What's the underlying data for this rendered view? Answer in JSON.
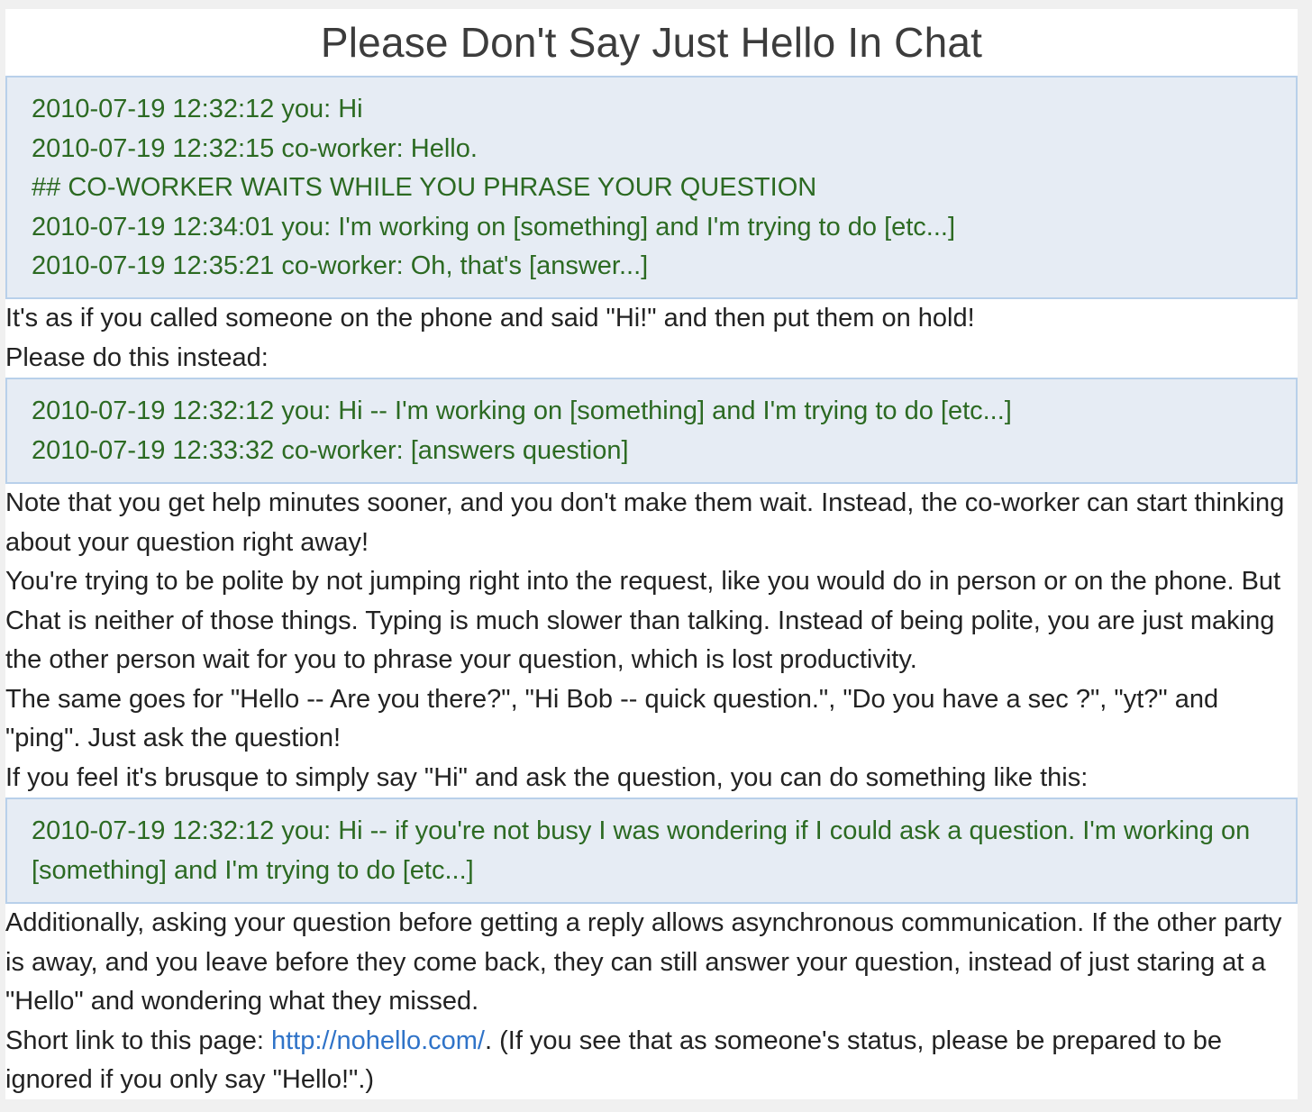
{
  "title": "Please Don't Say Just Hello In Chat",
  "chat_bad": [
    "2010-07-19 12:32:12 you: Hi",
    "2010-07-19 12:32:15 co-worker: Hello.",
    "## CO-WORKER WAITS WHILE YOU PHRASE YOUR QUESTION",
    "2010-07-19 12:34:01 you: I'm working on [something] and I'm trying to do [etc...]",
    "2010-07-19 12:35:21 co-worker: Oh, that's [answer...]"
  ],
  "para_phone": "It's as if you called someone on the phone and said \"Hi!\" and then put them on hold!",
  "para_instead": "Please do this instead:",
  "chat_good": [
    "2010-07-19 12:32:12 you: Hi -- I'm working on [something] and I'm trying to do [etc...]",
    "2010-07-19 12:33:32 co-worker: [answers question]"
  ],
  "para_note": "Note that you get help minutes sooner, and you don't make them wait. Instead, the co-worker can start thinking about your question right away!",
  "para_polite": "You're trying to be polite by not jumping right into the request, like you would do in person or on the phone. But Chat is neither of those things. Typing is much slower than talking. Instead of being polite, you are just making the other person wait for you to phrase your question, which is lost productivity.",
  "para_same": "The same goes for \"Hello -- Are you there?\", \"Hi Bob -- quick question.\", \"Do you have a sec ?\", \"yt?\" and \"ping\". Just ask the question!",
  "para_brusque": "If you feel it's brusque to simply say \"Hi\" and ask the question, you can do something like this:",
  "chat_polite": [
    "2010-07-19 12:32:12 you: Hi -- if you're not busy I was wondering if I could ask a question. I'm working on [something] and I'm trying to do [etc...]"
  ],
  "para_async": "Additionally, asking your question before getting a reply allows asynchronous communication. If the other party is away, and you leave before they come back, they can still answer your question, instead of just staring at a \"Hello\" and wondering what they missed.",
  "shortlink": {
    "prefix": "Short link to this page: ",
    "link_text": "http://nohello.com/",
    "suffix": ". (If you see that as someone's status, please be prepared to be ignored if you only say \"Hello!\".)"
  }
}
